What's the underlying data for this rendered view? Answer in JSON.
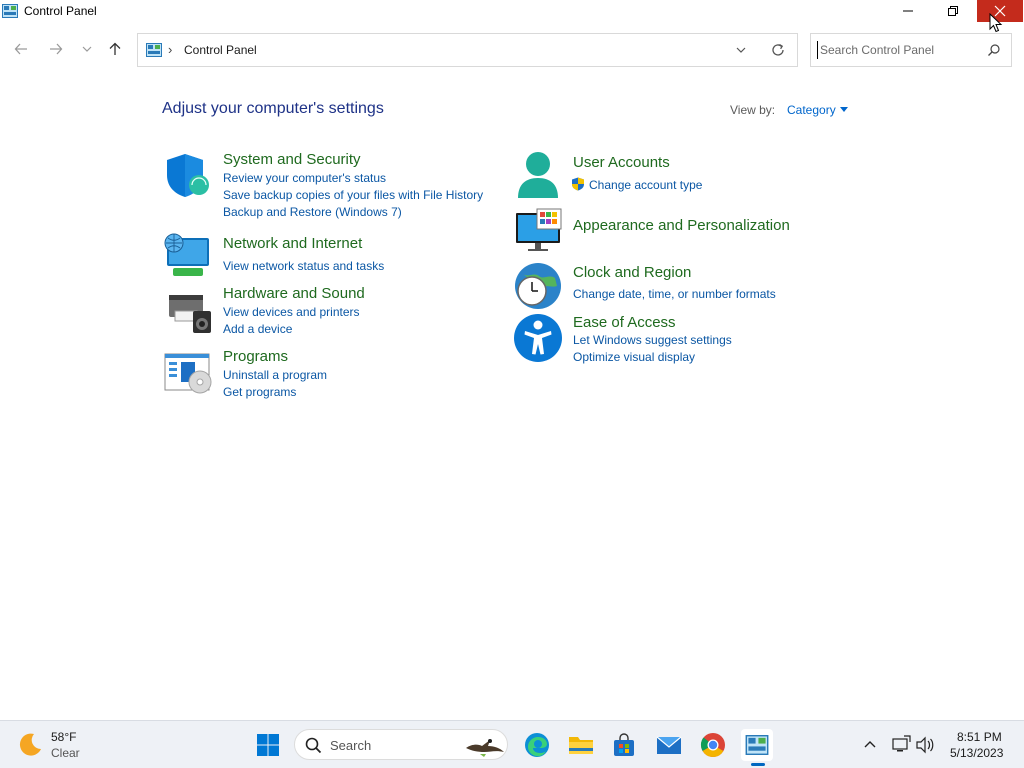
{
  "window": {
    "title": "Control Panel",
    "controls": {
      "minimize": "minimize",
      "maximize": "restore",
      "close": "close"
    }
  },
  "nav": {
    "back": "back-arrow",
    "forward": "forward-arrow",
    "recent": "chevron-down",
    "up": "up-arrow"
  },
  "address": {
    "separator": "›",
    "crumb": "Control Panel"
  },
  "search": {
    "placeholder": "Search Control Panel"
  },
  "content": {
    "heading": "Adjust your computer's settings",
    "view_by_label": "View by:",
    "view_by_value": "Category"
  },
  "categories": {
    "system": {
      "title": "System and Security",
      "links": [
        "Review your computer's status",
        "Save backup copies of your files with File History",
        "Backup and Restore (Windows 7)"
      ]
    },
    "network": {
      "title": "Network and Internet",
      "links": [
        "View network status and tasks"
      ]
    },
    "hardware": {
      "title": "Hardware and Sound",
      "links": [
        "View devices and printers",
        "Add a device"
      ]
    },
    "programs": {
      "title": "Programs",
      "links": [
        "Uninstall a program",
        "Get programs"
      ]
    },
    "accounts": {
      "title": "User Accounts",
      "links": [
        "Change account type"
      ]
    },
    "appearance": {
      "title": "Appearance and Personalization",
      "links": []
    },
    "clock": {
      "title": "Clock and Region",
      "links": [
        "Change date, time, or number formats"
      ]
    },
    "ease": {
      "title": "Ease of Access",
      "links": [
        "Let Windows suggest settings",
        "Optimize visual display"
      ]
    }
  },
  "taskbar": {
    "weather": {
      "temp": "58°F",
      "condition": "Clear"
    },
    "search_label": "Search",
    "clock": {
      "time": "8:51 PM",
      "date": "5/13/2023"
    }
  },
  "colors": {
    "heading": "#1e3287",
    "category_title": "#1f6a1f",
    "link": "#0b57a4",
    "close_button": "#c42b1c",
    "taskbar": "#eef1f6"
  }
}
